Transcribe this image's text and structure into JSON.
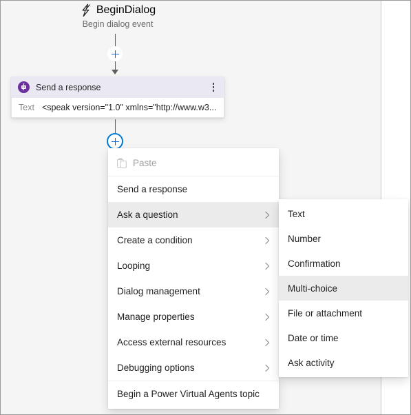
{
  "canvas": {
    "trigger": {
      "icon": "lightning-bolt-icon",
      "title": "BeginDialog",
      "subtitle": "Begin dialog event"
    },
    "action_node": {
      "icon": "bot-response-icon",
      "title": "Send a response",
      "menu_icon": "kebab-menu-icon",
      "field_label": "Text",
      "field_value": "<speak version=\"1.0\" xmlns=\"http://www.w3...."
    },
    "add_buttons": [
      {
        "name": "add-node-button-top",
        "icon": "plus-icon",
        "state": "normal"
      },
      {
        "name": "add-node-button-active",
        "icon": "plus-icon",
        "state": "focused"
      }
    ],
    "accent_color": "#0078d4",
    "node_header_color": "#eae8f2",
    "bot_badge_color": "#6b2fa0"
  },
  "context_menu": {
    "items": [
      {
        "label": "Paste",
        "icon": "clipboard-icon",
        "disabled": true,
        "submenu": false,
        "selected": false,
        "separator_after": true
      },
      {
        "label": "Send a response",
        "icon": null,
        "disabled": false,
        "submenu": false,
        "selected": false,
        "separator_after": false
      },
      {
        "label": "Ask a question",
        "icon": null,
        "disabled": false,
        "submenu": true,
        "selected": true,
        "separator_after": false
      },
      {
        "label": "Create a condition",
        "icon": null,
        "disabled": false,
        "submenu": true,
        "selected": false,
        "separator_after": false
      },
      {
        "label": "Looping",
        "icon": null,
        "disabled": false,
        "submenu": true,
        "selected": false,
        "separator_after": false
      },
      {
        "label": "Dialog management",
        "icon": null,
        "disabled": false,
        "submenu": true,
        "selected": false,
        "separator_after": false
      },
      {
        "label": "Manage properties",
        "icon": null,
        "disabled": false,
        "submenu": true,
        "selected": false,
        "separator_after": false
      },
      {
        "label": "Access external resources",
        "icon": null,
        "disabled": false,
        "submenu": true,
        "selected": false,
        "separator_after": false
      },
      {
        "label": "Debugging options",
        "icon": null,
        "disabled": false,
        "submenu": true,
        "selected": false,
        "separator_after": true
      },
      {
        "label": "Begin a Power Virtual Agents topic",
        "icon": null,
        "disabled": false,
        "submenu": false,
        "selected": false,
        "separator_after": false
      }
    ]
  },
  "sub_menu": {
    "parent": "Ask a question",
    "items": [
      {
        "label": "Text",
        "selected": false
      },
      {
        "label": "Number",
        "selected": false
      },
      {
        "label": "Confirmation",
        "selected": false
      },
      {
        "label": "Multi-choice",
        "selected": true
      },
      {
        "label": "File or attachment",
        "selected": false
      },
      {
        "label": "Date or time",
        "selected": false
      },
      {
        "label": "Ask activity",
        "selected": false
      }
    ]
  }
}
